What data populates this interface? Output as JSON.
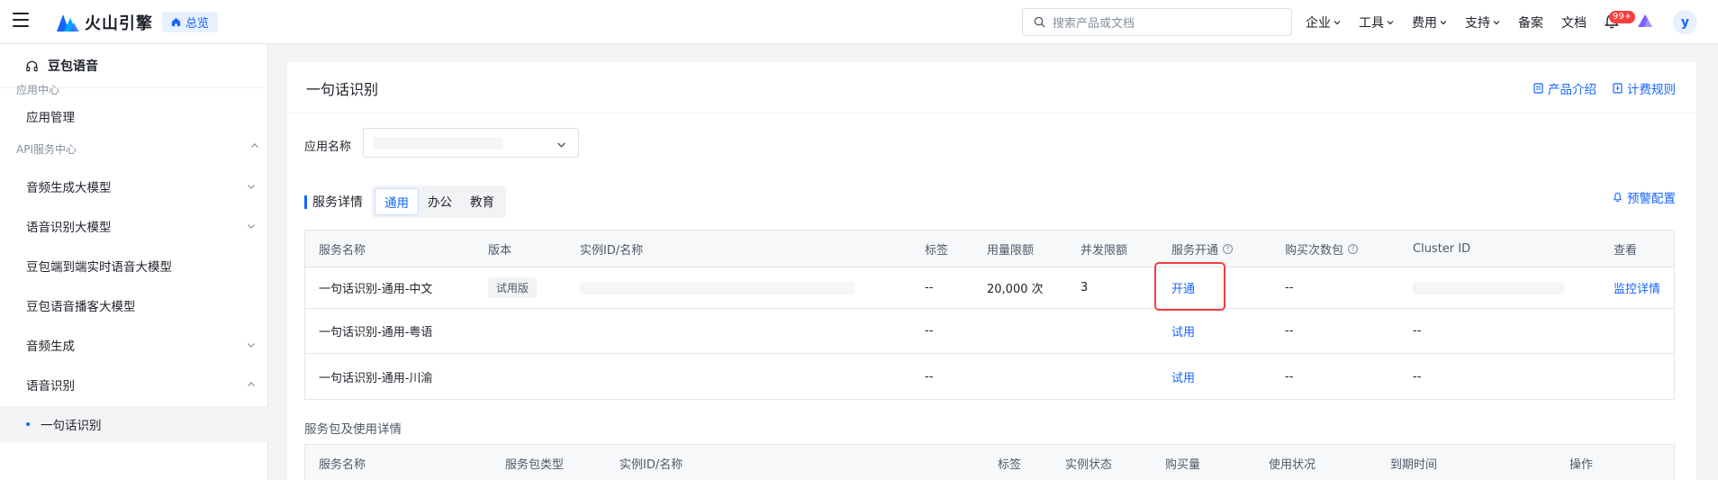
{
  "topbar": {
    "brand": "火山引擎",
    "home_chip": "总览",
    "search_placeholder": "搜索产品或文档",
    "nav": [
      {
        "label": "企业",
        "has_menu": true
      },
      {
        "label": "工具",
        "has_menu": true
      },
      {
        "label": "费用",
        "has_menu": true
      },
      {
        "label": "支持",
        "has_menu": true
      },
      {
        "label": "备案",
        "has_menu": false
      },
      {
        "label": "文档",
        "has_menu": false
      }
    ],
    "notification_badge": "99+",
    "avatar_initial": "y",
    "colors": {
      "accent": "#1664ff",
      "badge": "#f53f3f"
    }
  },
  "sidebar": {
    "product": "豆包语音",
    "groups": [
      "应用中心",
      "API服务中心"
    ],
    "items": [
      {
        "label": "应用管理"
      },
      {
        "label": "音频生成大模型"
      },
      {
        "label": "语音识别大模型"
      },
      {
        "label": "豆包端到端实时语音大模型"
      },
      {
        "label": "豆包语音播客大模型"
      },
      {
        "label": "音频生成"
      },
      {
        "label": "语音识别"
      },
      {
        "label": "一句话识别"
      }
    ]
  },
  "main": {
    "title": "一句话识别",
    "links": [
      "产品介绍",
      "计费规则"
    ],
    "app_label": "应用名称",
    "service_section": "服务详情",
    "tabs": [
      "通用",
      "办公",
      "教育"
    ],
    "active_tab": "通用",
    "alert_config": "预警配置",
    "service_table": {
      "headers": [
        "服务名称",
        "版本",
        "实例ID/名称",
        "标签",
        "用量限额",
        "并发限额",
        "服务开通",
        "购买次数包",
        "Cluster ID",
        "查看"
      ],
      "rows": [
        {
          "name": "一句话识别-通用-中文",
          "version": "试用版",
          "tag": "--",
          "quota": "20,000 次",
          "concurrency": "3",
          "action": "开通",
          "packs": "--",
          "view": "监控详情"
        },
        {
          "name": "一句话识别-通用-粤语",
          "tag": "--",
          "action": "试用",
          "packs": "--",
          "cluster": "--"
        },
        {
          "name": "一句话识别-通用-川渝",
          "tag": "--",
          "action": "试用",
          "packs": "--",
          "cluster": "--"
        }
      ]
    },
    "package_section": "服务包及使用详情",
    "package_table": {
      "headers": [
        "服务名称",
        "服务包类型",
        "实例ID/名称",
        "标签",
        "实例状态",
        "购买量",
        "使用状况",
        "到期时间",
        "操作"
      ]
    }
  }
}
